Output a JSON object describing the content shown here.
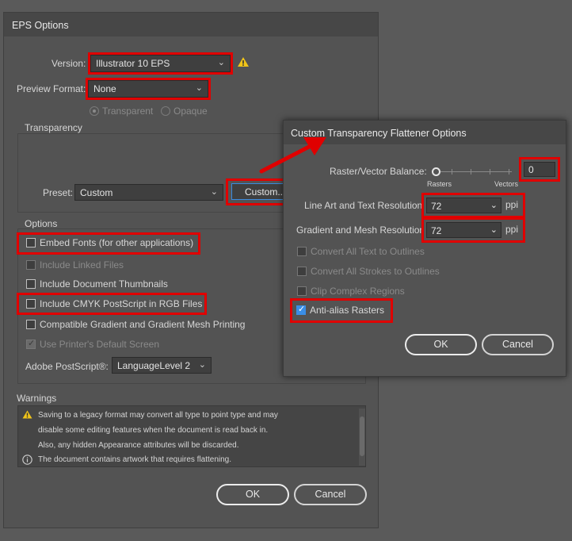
{
  "eps_dialog": {
    "title": "EPS Options",
    "version_label": "Version:",
    "version_value": "Illustrator 10 EPS",
    "preview_format_label": "Preview Format:",
    "preview_format_value": "None",
    "radio_transparent": "Transparent",
    "radio_opaque": "Opaque",
    "transparency_group": "Transparency",
    "preset_label": "Preset:",
    "preset_value": "Custom",
    "custom_button": "Custom...",
    "options_group": "Options",
    "checkboxes": [
      {
        "label": "Embed Fonts (for other applications)",
        "checked": false,
        "enabled": true
      },
      {
        "label": "Include Linked Files",
        "checked": false,
        "enabled": false
      },
      {
        "label": "Include Document Thumbnails",
        "checked": false,
        "enabled": true
      },
      {
        "label": "Include CMYK PostScript in RGB Files",
        "checked": false,
        "enabled": true
      },
      {
        "label": "Compatible Gradient and Gradient Mesh Printing",
        "checked": false,
        "enabled": true
      },
      {
        "label": "Use Printer's Default Screen",
        "checked": true,
        "enabled": false
      }
    ],
    "postscript_label": "Adobe PostScript®:",
    "postscript_value": "LanguageLevel 2",
    "warnings_group": "Warnings",
    "warnings": [
      "Saving to a legacy format may convert all type to point type and may",
      "disable some editing features when the document is read back in.",
      "Also, any hidden Appearance attributes will be discarded.",
      "The document contains artwork that requires flattening."
    ],
    "ok": "OK",
    "cancel": "Cancel"
  },
  "flattener_dialog": {
    "title": "Custom Transparency Flattener Options",
    "balance_label": "Raster/Vector Balance:",
    "balance_value": "0",
    "balance_level": 0,
    "rasters_label": "Rasters",
    "vectors_label": "Vectors",
    "line_art_label": "Line Art and Text Resolution",
    "line_art_value": "72",
    "gradient_label": "Gradient and Mesh Resolution",
    "gradient_value": "72",
    "ppi": "ppi",
    "checkboxes": [
      {
        "label": "Convert All Text to Outlines",
        "checked": false,
        "enabled": false
      },
      {
        "label": "Convert All Strokes to Outlines",
        "checked": false,
        "enabled": false
      },
      {
        "label": "Clip Complex Regions",
        "checked": false,
        "enabled": false
      },
      {
        "label": "Anti-alias Rasters",
        "checked": true,
        "enabled": true
      }
    ],
    "ok": "OK",
    "cancel": "Cancel"
  },
  "colors": {
    "highlight": "#e00000",
    "accent": "#3a8ee6",
    "warning": "#f0c419"
  }
}
